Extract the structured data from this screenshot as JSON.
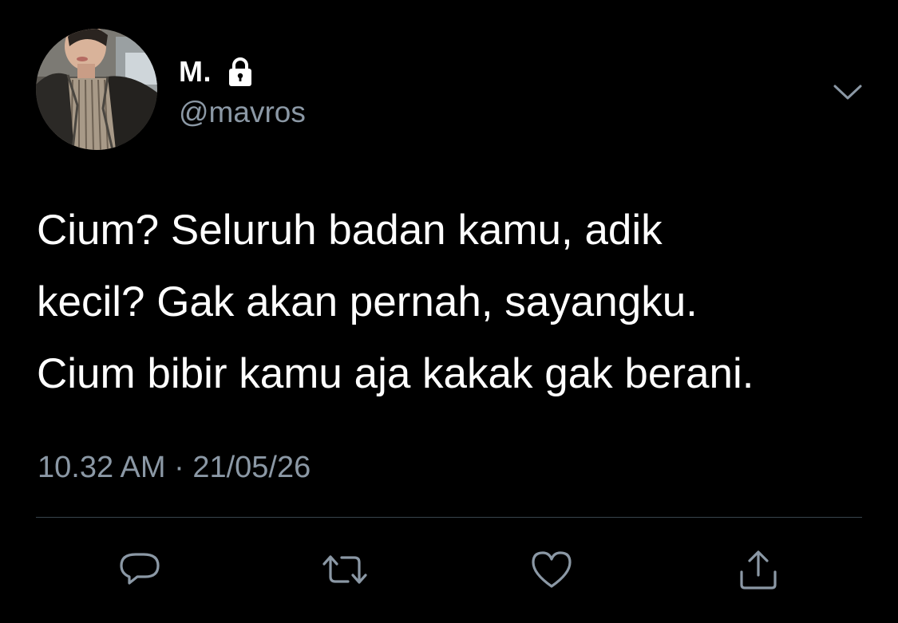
{
  "colors": {
    "background": "#000000",
    "primary_text": "#ffffff",
    "secondary_text": "#8b98a5",
    "divider": "#38444d"
  },
  "tweet": {
    "display_name": "M.",
    "handle": "@mavros",
    "protected_icon": "lock-icon",
    "menu_icon": "chevron-down-icon",
    "text_lines": [
      "Cium? Seluruh badan kamu, adik",
      "kecil? Gak akan pernah, sayangku.",
      "Cium bibir kamu aja kakak gak berani."
    ],
    "time": "10.32 AM",
    "separator": "·",
    "date": "21/05/26"
  },
  "actions": [
    {
      "icon": "reply-icon"
    },
    {
      "icon": "retweet-icon"
    },
    {
      "icon": "like-icon"
    },
    {
      "icon": "share-icon"
    }
  ]
}
